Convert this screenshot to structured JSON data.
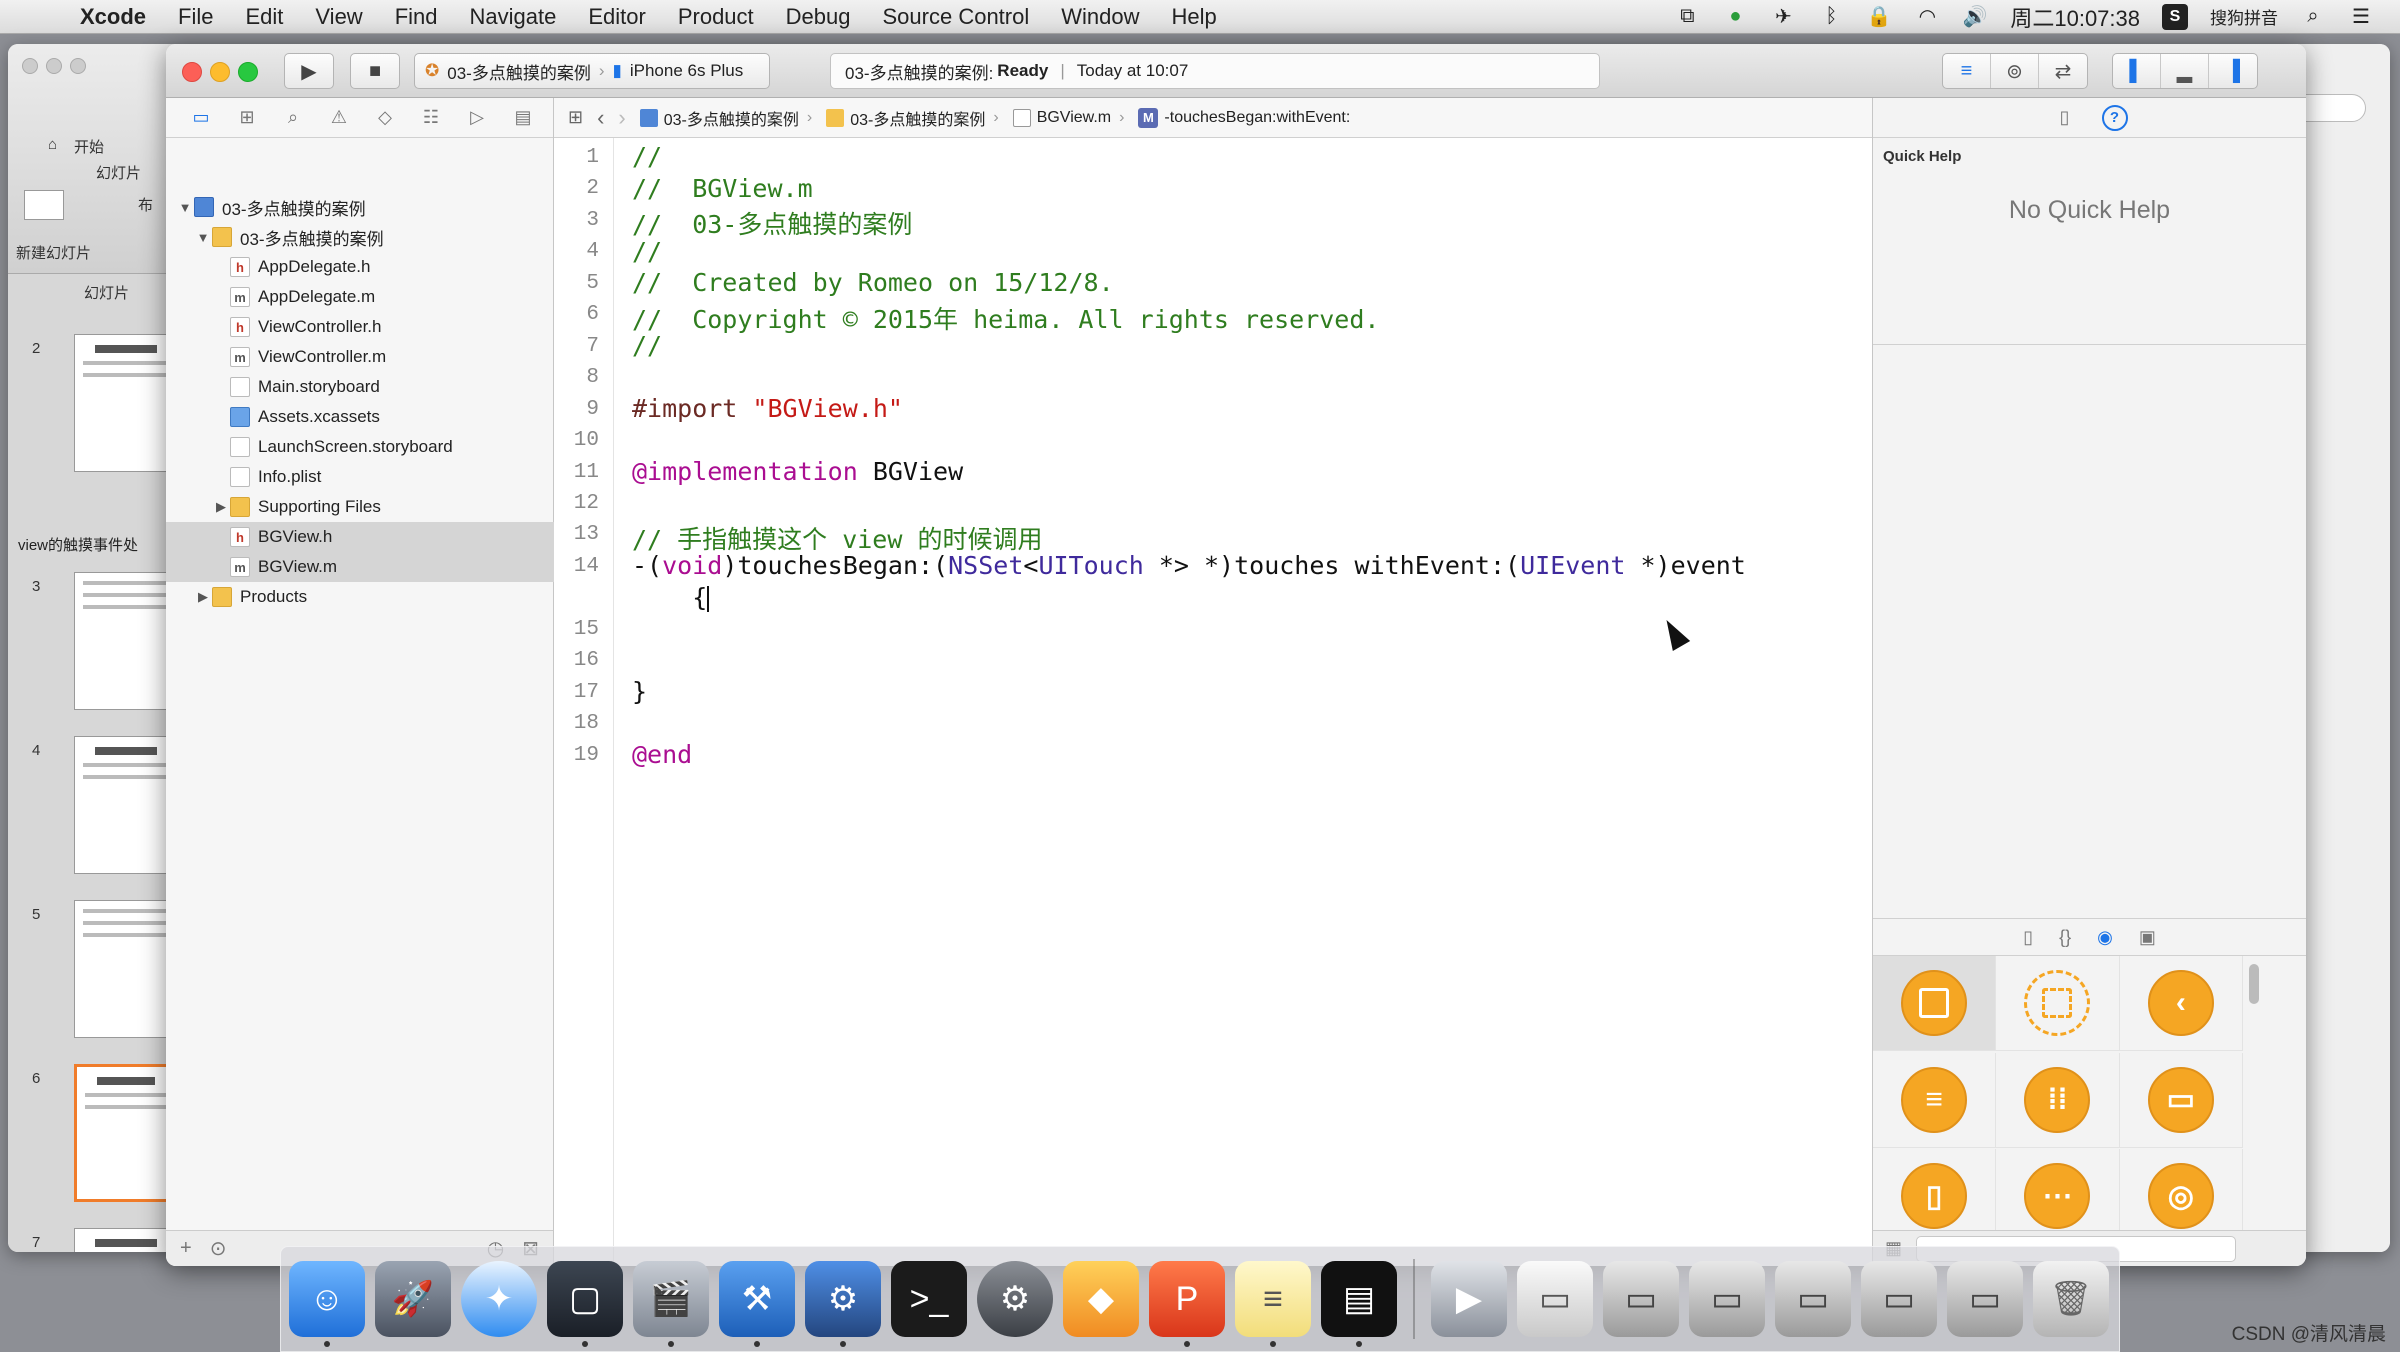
{
  "menubar": {
    "app_name": "Xcode",
    "items": [
      "File",
      "Edit",
      "View",
      "Find",
      "Navigate",
      "Editor",
      "Product",
      "Debug",
      "Source Control",
      "Window",
      "Help"
    ],
    "clock": "周二10:07:38",
    "input_method": "搜狗拼音"
  },
  "background_window": {
    "tab_home": "开始",
    "tab_slides": "幻灯片",
    "new_slide_label": "新建幻灯片",
    "layout_label": "布",
    "slides_header": "幻灯片",
    "slide_numbers": [
      "2",
      "3",
      "4",
      "5",
      "6",
      "7"
    ],
    "section_label": "view的触摸事件处"
  },
  "toolbar": {
    "scheme_project": "03-多点触摸的案例",
    "scheme_device": "iPhone 6s Plus",
    "activity_project": "03-多点触摸的案例:",
    "activity_status": "Ready",
    "activity_time": "Today at 10:07"
  },
  "navigator": {
    "items": [
      {
        "label": "03-多点触摸的案例",
        "type": "proj",
        "indent": 0,
        "arrow": "▼"
      },
      {
        "label": "03-多点触摸的案例",
        "type": "folder",
        "indent": 1,
        "arrow": "▼"
      },
      {
        "label": "AppDelegate.h",
        "type": "h",
        "indent": 2,
        "arrow": ""
      },
      {
        "label": "AppDelegate.m",
        "type": "m",
        "indent": 2,
        "arrow": ""
      },
      {
        "label": "ViewController.h",
        "type": "h",
        "indent": 2,
        "arrow": ""
      },
      {
        "label": "ViewController.m",
        "type": "m",
        "indent": 2,
        "arrow": ""
      },
      {
        "label": "Main.storyboard",
        "type": "sb",
        "indent": 2,
        "arrow": ""
      },
      {
        "label": "Assets.xcassets",
        "type": "assets",
        "indent": 2,
        "arrow": ""
      },
      {
        "label": "LaunchScreen.storyboard",
        "type": "sb",
        "indent": 2,
        "arrow": ""
      },
      {
        "label": "Info.plist",
        "type": "plist",
        "indent": 2,
        "arrow": ""
      },
      {
        "label": "Supporting Files",
        "type": "folder",
        "indent": 2,
        "arrow": "▶"
      },
      {
        "label": "BGView.h",
        "type": "h",
        "indent": 2,
        "arrow": "",
        "selected": true
      },
      {
        "label": "BGView.m",
        "type": "m",
        "indent": 2,
        "arrow": "",
        "selected": true
      },
      {
        "label": "Products",
        "type": "folder",
        "indent": 1,
        "arrow": "▶"
      }
    ]
  },
  "jumpbar": {
    "project": "03-多点触摸的案例",
    "group": "03-多点触摸的案例",
    "file": "BGView.m",
    "method_badge": "M",
    "method": "-touchesBegan:withEvent:"
  },
  "editor": {
    "line_numbers": [
      "1",
      "2",
      "3",
      "4",
      "5",
      "6",
      "7",
      "8",
      "9",
      "10",
      "11",
      "12",
      "13",
      "14",
      "",
      "15",
      "16",
      "17",
      "18",
      "19"
    ],
    "lines": {
      "l1": "//",
      "l2": "//  BGView.m",
      "l3": "//  03-多点触摸的案例",
      "l4": "//",
      "l5": "//  Created by Romeo on 15/12/8.",
      "l6": "//  Copyright © 2015年 heima. All rights reserved.",
      "l7": "//",
      "l9_directive": "#import ",
      "l9_string": "\"BGView.h\"",
      "l11_kw": "@implementation",
      "l11_name": " BGView",
      "l13": "// 手指触摸这个 view 的时候调用",
      "l14_a": "-(",
      "l14_void": "void",
      "l14_b": ")touchesBegan:(",
      "l14_nsset": "NSSet",
      "l14_c": "<",
      "l14_uitouch": "UITouch",
      "l14_d": " *> *)touches withEvent:(",
      "l14_uievent": "UIEvent",
      "l14_e": " *)event",
      "l14_brace": "    {",
      "l16": "}",
      "l18": "@end"
    }
  },
  "utilities": {
    "quick_help_title": "Quick Help",
    "quick_help_empty": "No Quick Help"
  },
  "watermark": "CSDN @清风清晨",
  "colors": {
    "comment": "#2f7d1f",
    "keyword": "#aa0d91",
    "string": "#c41a16",
    "class": "#3f2a9c",
    "accent": "#1d74e7",
    "library_orange": "#f5a623"
  }
}
